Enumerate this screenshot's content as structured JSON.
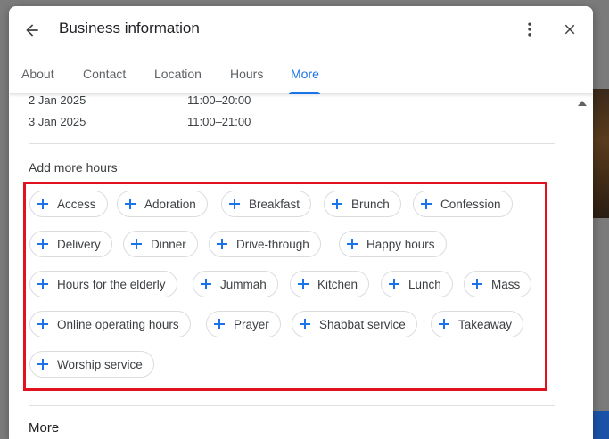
{
  "dialog": {
    "title": "Business information",
    "tabs": [
      {
        "label": "About"
      },
      {
        "label": "Contact"
      },
      {
        "label": "Location"
      },
      {
        "label": "Hours"
      },
      {
        "label": "More"
      }
    ],
    "active_tab": "More"
  },
  "hours": [
    {
      "date": "2 Jan 2025",
      "time": "11:00–20:00"
    },
    {
      "date": "3 Jan 2025",
      "time": "11:00–21:00"
    }
  ],
  "add_more_hours": {
    "title": "Add more hours",
    "chips": [
      "Access",
      "Adoration",
      "Breakfast",
      "Brunch",
      "Confession",
      "Delivery",
      "Dinner",
      "Drive-through",
      "Happy hours",
      "Hours for the elderly",
      "Jummah",
      "Kitchen",
      "Lunch",
      "Mass",
      "Online operating hours",
      "Prayer",
      "Shabbat service",
      "Takeaway",
      "Worship service"
    ]
  },
  "more_section": {
    "title": "More"
  },
  "colors": {
    "accent": "#1a73e8",
    "highlight_border": "#e0121f"
  },
  "icons": {
    "back": "arrow-back-icon",
    "menu": "more-vert-icon",
    "close": "close-icon",
    "chip": "plus-icon"
  }
}
